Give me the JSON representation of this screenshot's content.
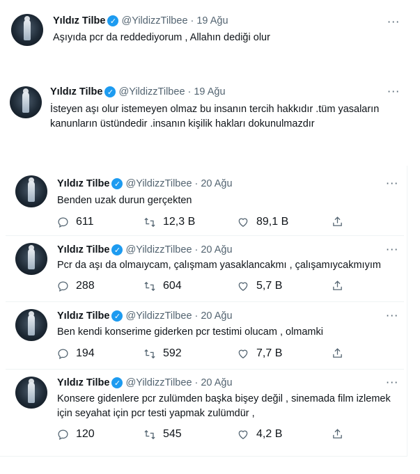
{
  "tweets": [
    {
      "name": "Yıldız Tilbe",
      "handle": "@YildizzTilbee",
      "date": "19 Ağu",
      "text": "Aşıyıda pcr da reddediyorum , Allahın dediği olur"
    },
    {
      "name": "Yıldız Tilbe",
      "handle": "@YildizzTilbee",
      "date": "19 Ağu",
      "text": "İsteyen aşı olur istemeyen olmaz bu insanın tercih hakkıdır .tüm yasaların kanunların üstündedir .insanın kişilik hakları dokunulmazdır"
    },
    {
      "name": "Yıldız Tilbe",
      "handle": "@YildizzTilbee",
      "date": "20 Ağu",
      "text": "Benden uzak durun gerçekten",
      "replies": "611",
      "retweets": "12,3 B",
      "likes": "89,1 B"
    },
    {
      "name": "Yıldız Tilbe",
      "handle": "@YildizzTilbee",
      "date": "20 Ağu",
      "text": "Pcr da aşı da olmaıycam, çalışmam yasaklancakmı , çalışamıycakmıyım",
      "replies": "288",
      "retweets": "604",
      "likes": "5,7 B"
    },
    {
      "name": "Yıldız Tilbe",
      "handle": "@YildizzTilbee",
      "date": "20 Ağu",
      "text": "Ben kendi konserime giderken pcr testimi olucam , olmamki",
      "replies": "194",
      "retweets": "592",
      "likes": "7,7 B"
    },
    {
      "name": "Yıldız Tilbe",
      "handle": "@YildizzTilbee",
      "date": "20 Ağu",
      "text": "Konsere gidenlere pcr zulümden başka bişey değil , sinemada film izlemek için seyahat için pcr testi yapmak zulümdür ,",
      "replies": "120",
      "retweets": "545",
      "likes": "4,2 B"
    }
  ],
  "icons": {
    "verified": "verified-badge-icon",
    "more": "more-icon",
    "reply": "reply-icon",
    "retweet": "retweet-icon",
    "like": "like-icon",
    "share": "share-icon"
  },
  "colors": {
    "accent": "#1d9bf0",
    "secondary_text": "#536471",
    "primary_text": "#0f1419"
  }
}
